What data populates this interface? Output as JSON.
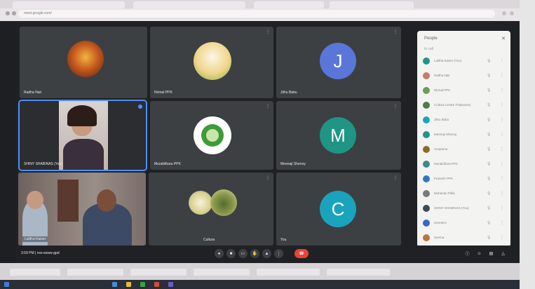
{
  "browser": {
    "url": "meet.google.com/"
  },
  "tiles": [
    {
      "name": "Radha Nair",
      "kind": "image"
    },
    {
      "name": "Nirmal PPK",
      "kind": "logo"
    },
    {
      "name": "Jithu Babu",
      "kind": "avatar",
      "initial": "J",
      "color": "#5b76d9"
    },
    {
      "name": "SHINY SHABINAS (You)",
      "kind": "video"
    },
    {
      "name": "Muralidhara PPK",
      "kind": "logo"
    },
    {
      "name": "Meenaji Shenoy",
      "kind": "avatar",
      "initial": "M",
      "color": "#1e9585"
    },
    {
      "name": "Lalitha Kaiser",
      "kind": "video"
    },
    {
      "name": "Cultura",
      "kind": "logo"
    },
    {
      "name": "You",
      "kind": "avatar",
      "initial": "C",
      "color": "#1aa3bd"
    }
  ],
  "people_panel": {
    "title": "People",
    "subtitle": "In call",
    "participants": [
      {
        "name": "Lalitha Kaiser (You)",
        "color": "#1e9585"
      },
      {
        "name": "Radha Nair",
        "color": "#c87b6a"
      },
      {
        "name": "Nirmal PPK",
        "color": "#6a9a5f"
      },
      {
        "name": "Cultura Centre Thalassery",
        "color": "#4f7a4a"
      },
      {
        "name": "Jithu Babu",
        "color": "#1aa3bd"
      },
      {
        "name": "Meenaji Shenoy",
        "color": "#1e9585"
      },
      {
        "name": "Anupama",
        "color": "#8a6a2e"
      },
      {
        "name": "Muralidhara PPK",
        "color": "#3d8a8a"
      },
      {
        "name": "Pranesh PPK",
        "color": "#2f78c4"
      },
      {
        "name": "Mohanan Pillai",
        "color": "#7a7a7a"
      },
      {
        "name": "SHINY SHABINAS (You)",
        "color": "#3a4a58"
      },
      {
        "name": "Sreedevi",
        "color": "#3a66c9"
      },
      {
        "name": "Seema",
        "color": "#b8763a"
      }
    ]
  },
  "bottom_bar": {
    "time_label": "3:59 PM | nvs-wosw-gpd"
  }
}
